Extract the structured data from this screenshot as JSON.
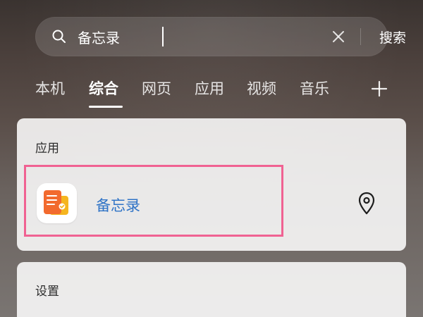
{
  "search": {
    "value": "备忘录",
    "action_label": "搜索"
  },
  "tabs": [
    {
      "label": "本机",
      "active": false
    },
    {
      "label": "综合",
      "active": true
    },
    {
      "label": "网页",
      "active": false
    },
    {
      "label": "应用",
      "active": false
    },
    {
      "label": "视频",
      "active": false
    },
    {
      "label": "音乐",
      "active": false
    }
  ],
  "sections": {
    "apps": {
      "title": "应用",
      "items": [
        {
          "label": "备忘录"
        }
      ]
    },
    "settings": {
      "title": "设置"
    }
  },
  "icons": {
    "search": "search-icon",
    "clear": "close-icon",
    "add": "plus-icon",
    "location": "location-pin-icon",
    "app": "memo-app-icon"
  },
  "colors": {
    "highlight": "#f06292",
    "app_label": "#2f73c6"
  }
}
